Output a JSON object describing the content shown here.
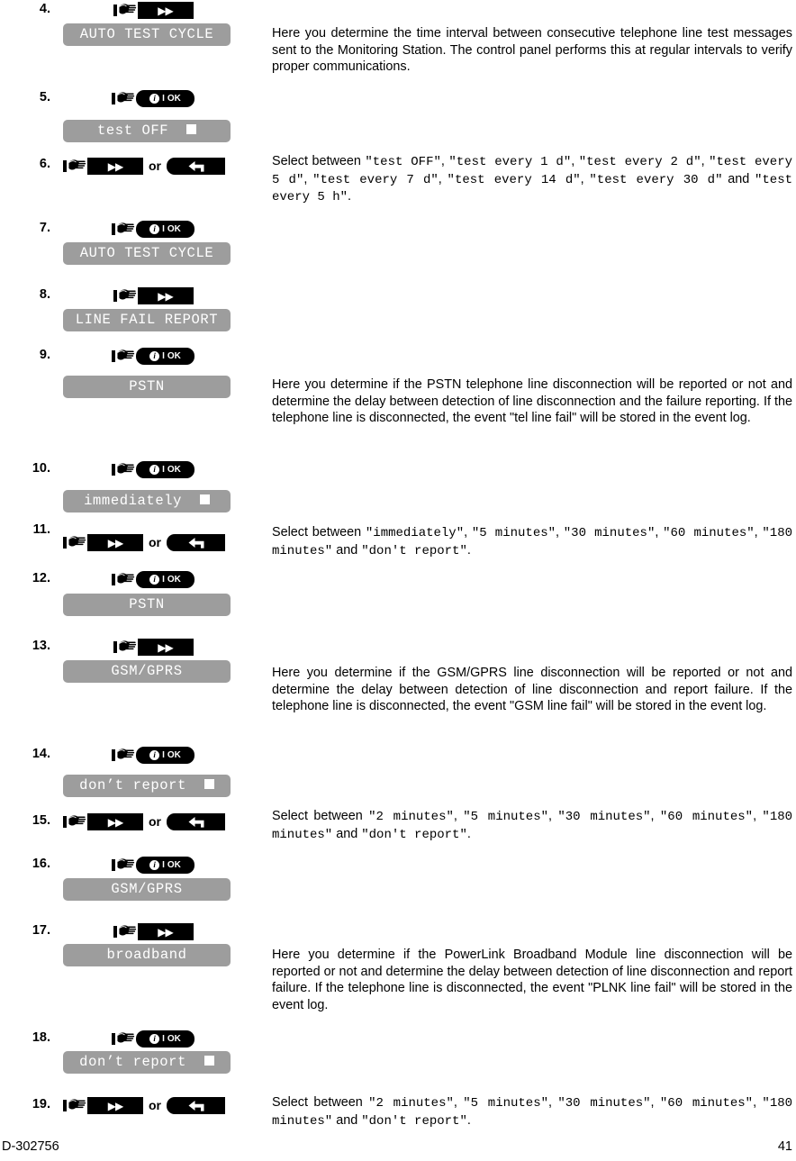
{
  "document": {
    "footer_left": "D-302756",
    "footer_right": "41"
  },
  "icons": {
    "hand": "hand-pointer-icon",
    "next_key": "next-key-icon",
    "ok_key": "ok-key-icon",
    "back_key": "back-key-icon",
    "checkbox": "selected-checkbox-icon"
  },
  "keys": {
    "next_label": "▶▶",
    "ok_info": "i",
    "ok_sep": "I",
    "ok_label": "OK",
    "back_label": "↩",
    "or_label": "or"
  },
  "steps": [
    {
      "number": "4.",
      "key": "next",
      "lcd": "AUTO TEST CYCLE",
      "description_parts": [
        {
          "type": "text",
          "value": "Here you determine the time interval between consecutive telephone line test messages sent to the Monitoring Station. The control panel performs this at regular intervals to verify proper communications."
        }
      ]
    },
    {
      "number": "5.",
      "key": "ok",
      "lcd": "test OFF",
      "lcd_checkbox": true
    },
    {
      "number": "6.",
      "key": "next_or_back",
      "description_parts": [
        {
          "type": "text",
          "value": "Select between "
        },
        {
          "type": "mono",
          "value": "\"test OFF\""
        },
        {
          "type": "text",
          "value": ", "
        },
        {
          "type": "mono",
          "value": "\"test every 1 d\""
        },
        {
          "type": "text",
          "value": ", "
        },
        {
          "type": "mono",
          "value": "\"test every 2 d\""
        },
        {
          "type": "text",
          "value": ", "
        },
        {
          "type": "mono",
          "value": "\"test every 5 d\""
        },
        {
          "type": "text",
          "value": ", "
        },
        {
          "type": "mono",
          "value": "\"test every 7 d\""
        },
        {
          "type": "text",
          "value": ", "
        },
        {
          "type": "mono",
          "value": "\"test every 14 d\""
        },
        {
          "type": "text",
          "value": ", "
        },
        {
          "type": "mono",
          "value": "\"test every 30 d\""
        },
        {
          "type": "text",
          "value": " and "
        },
        {
          "type": "mono",
          "value": "\"test every 5 h\""
        },
        {
          "type": "text",
          "value": "."
        }
      ]
    },
    {
      "number": "7.",
      "key": "ok",
      "lcd": "AUTO TEST CYCLE"
    },
    {
      "number": "8.",
      "key": "next",
      "lcd": "LINE FAIL REPORT"
    },
    {
      "number": "9.",
      "key": "ok",
      "lcd": "PSTN",
      "description_parts": [
        {
          "type": "text",
          "value": "Here you determine if the PSTN telephone line disconnection will be reported or not and determine the delay between detection of line disconnection and the failure reporting. If the telephone line is disconnected, the event \"tel line fail\" will be stored in the event log."
        }
      ]
    },
    {
      "number": "10.",
      "key": "ok",
      "lcd": "immediately",
      "lcd_checkbox": true
    },
    {
      "number": "11.",
      "key": "next_or_back",
      "description_parts": [
        {
          "type": "text",
          "value": "Select between "
        },
        {
          "type": "mono",
          "value": "\"immediately\""
        },
        {
          "type": "text",
          "value": ", "
        },
        {
          "type": "mono",
          "value": "\"5 minutes\""
        },
        {
          "type": "text",
          "value": ", "
        },
        {
          "type": "mono",
          "value": "\"30 minutes\""
        },
        {
          "type": "text",
          "value": ", "
        },
        {
          "type": "mono",
          "value": "\"60 minutes\""
        },
        {
          "type": "text",
          "value": ", "
        },
        {
          "type": "mono",
          "value": "\"180 minutes\""
        },
        {
          "type": "text",
          "value": " and "
        },
        {
          "type": "mono",
          "value": "\"don't report\""
        },
        {
          "type": "text",
          "value": "."
        }
      ]
    },
    {
      "number": "12.",
      "key": "ok",
      "lcd": "PSTN"
    },
    {
      "number": "13.",
      "key": "next",
      "lcd": "GSM/GPRS",
      "description_parts": [
        {
          "type": "text",
          "value": "Here you determine if the GSM/GPRS line disconnection will be reported or not and determine the delay between detection of line disconnection and report failure. If the telephone line is disconnected, the event \"GSM line fail\" will be stored in the event log."
        }
      ]
    },
    {
      "number": "14.",
      "key": "ok",
      "lcd": "don’t report",
      "lcd_checkbox": true
    },
    {
      "number": "15.",
      "key": "next_or_back",
      "description_parts": [
        {
          "type": "text",
          "value": "Select between "
        },
        {
          "type": "mono",
          "value": "\"2 minutes\""
        },
        {
          "type": "text",
          "value": ", "
        },
        {
          "type": "mono",
          "value": "\"5 minutes\""
        },
        {
          "type": "text",
          "value": ", "
        },
        {
          "type": "mono",
          "value": "\"30 minutes\""
        },
        {
          "type": "text",
          "value": ", "
        },
        {
          "type": "mono",
          "value": "\"60 minutes\""
        },
        {
          "type": "text",
          "value": ", "
        },
        {
          "type": "mono",
          "value": "\"180 minutes\""
        },
        {
          "type": "text",
          "value": " and "
        },
        {
          "type": "mono",
          "value": "\"don't report\""
        },
        {
          "type": "text",
          "value": "."
        }
      ]
    },
    {
      "number": "16.",
      "key": "ok",
      "lcd": "GSM/GPRS"
    },
    {
      "number": "17.",
      "key": "next",
      "lcd": "broadband",
      "description_parts": [
        {
          "type": "text",
          "value": "Here you determine if the PowerLink Broadband Module line disconnection will be reported or not and determine the delay between detection of line disconnection and report failure. If the telephone line is disconnected, the event \"PLNK line fail\" will be stored in the event log."
        }
      ]
    },
    {
      "number": "18.",
      "key": "ok",
      "lcd": "don’t report",
      "lcd_checkbox": true
    },
    {
      "number": "19.",
      "key": "next_or_back",
      "description_parts": [
        {
          "type": "text",
          "value": "Select between "
        },
        {
          "type": "mono",
          "value": "\"2 minutes\""
        },
        {
          "type": "text",
          "value": ", "
        },
        {
          "type": "mono",
          "value": "\"5 minutes\""
        },
        {
          "type": "text",
          "value": ", "
        },
        {
          "type": "mono",
          "value": "\"30 minutes\""
        },
        {
          "type": "text",
          "value": ", "
        },
        {
          "type": "mono",
          "value": "\"60 minutes\""
        },
        {
          "type": "text",
          "value": ", "
        },
        {
          "type": "mono",
          "value": "\"180 minutes\""
        },
        {
          "type": "text",
          "value": " and "
        },
        {
          "type": "mono",
          "value": "\"don't report\""
        },
        {
          "type": "text",
          "value": "."
        }
      ]
    }
  ],
  "layout": {
    "step_tops": [
      2,
      100,
      174,
      245,
      319,
      386,
      512,
      580,
      634,
      709,
      829,
      903,
      951,
      1025,
      1144,
      1218
    ],
    "lcd_tops": [
      26,
      133,
      null,
      269,
      343,
      417,
      544,
      null,
      659,
      733,
      860,
      null,
      975,
      1048,
      1167,
      null
    ],
    "desc_tops": [
      28,
      null,
      170,
      null,
      null,
      418,
      null,
      582,
      null,
      738,
      null,
      897,
      null,
      1051,
      null,
      1215
    ],
    "key_tops": [
      1,
      99,
      174,
      244,
      318,
      385,
      511,
      592,
      633,
      708,
      828,
      902,
      950,
      1024,
      1143,
      1217
    ],
    "narrow_lcds": [
      11
    ]
  }
}
